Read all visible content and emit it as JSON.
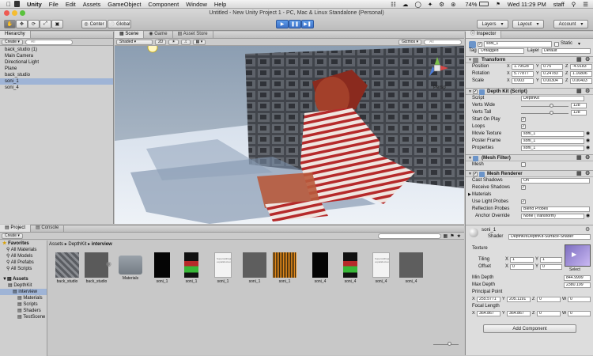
{
  "menubar": {
    "app": "Unity",
    "items": [
      "File",
      "Edit",
      "Assets",
      "GameObject",
      "Component",
      "Window",
      "Help"
    ],
    "battery": "74%",
    "clock": "Wed 11:29 PM",
    "user": "staff"
  },
  "window": {
    "title": "Untitled - New Unity Project 1 - PC, Mac & Linux Standalone (Personal)"
  },
  "toolbar": {
    "center": "Center",
    "global": "Global",
    "layers": "Layers",
    "layout": "Layout",
    "account": "Account"
  },
  "hierarchy": {
    "tab": "Hierarchy",
    "create": "Create",
    "search": "All",
    "items": [
      {
        "label": "back_studio (1)",
        "sel": false
      },
      {
        "label": "Main Camera",
        "sel": false
      },
      {
        "label": "Directional Light",
        "sel": false
      },
      {
        "label": "Plane",
        "sel": false
      },
      {
        "label": "back_studio",
        "sel": false
      },
      {
        "label": "soni_1",
        "sel": true
      },
      {
        "label": "soni_4",
        "sel": false
      }
    ]
  },
  "scene": {
    "tabs": [
      "Scene",
      "Game",
      "Asset Store"
    ],
    "shaded": "Shaded",
    "mode2d": "2D",
    "gizmos": "Gizmos",
    "search": "All",
    "persp": "Persp"
  },
  "project": {
    "tabs": [
      "Project",
      "Console"
    ],
    "create": "Create",
    "search": "",
    "breadcrumb": [
      "Assets",
      "DepthKit",
      "interview"
    ],
    "favorites_label": "Favorites",
    "favorites": [
      "All Materials",
      "All Models",
      "All Prefabs",
      "All Scripts"
    ],
    "assets_label": "Assets",
    "tree": [
      "DepthKit",
      "interview",
      "Materials",
      "Scripts",
      "Shaders",
      "TestScene"
    ],
    "items": [
      {
        "label": "back_studio",
        "kind": "photo"
      },
      {
        "label": "back_studio",
        "kind": "dark"
      },
      {
        "label": "Materials",
        "kind": "folder"
      },
      {
        "label": "soni_1",
        "kind": "black"
      },
      {
        "label": "soni_1",
        "kind": "figure"
      },
      {
        "label": "soni_1",
        "kind": "doc"
      },
      {
        "label": "soni_1",
        "kind": "gray"
      },
      {
        "label": "soni_1",
        "kind": "audio"
      },
      {
        "label": "soni_4",
        "kind": "black"
      },
      {
        "label": "soni_4",
        "kind": "figure"
      },
      {
        "label": "soni_4",
        "kind": "doc"
      },
      {
        "label": "soni_4",
        "kind": "gray"
      }
    ],
    "doc_text": "Supercalifragilistic expialidocious"
  },
  "inspector": {
    "tab": "Inspector",
    "object_name": "soni_1",
    "static": "Static",
    "tag_label": "Tag",
    "tag": "Untagged",
    "layer_label": "Layer",
    "layer": "Default",
    "transform": {
      "title": "Transform",
      "rows": [
        {
          "label": "Position",
          "x": "1.79528",
          "y": "0.75",
          "z": "-4.9183"
        },
        {
          "label": "Rotation",
          "x": "5.77877",
          "y": "0.24783",
          "z": "1.16806"
        },
        {
          "label": "Scale",
          "x": "0.003",
          "y": "0.00304",
          "z": "0.00403"
        }
      ]
    },
    "depthkit": {
      "title": "Depth Kit (Script)",
      "script_label": "Script",
      "script": "DepthKit",
      "verts_wide_label": "Verts Wide",
      "verts_wide": "128",
      "verts_wide_frac": 0.65,
      "verts_tall_label": "Verts Tall",
      "verts_tall": "128",
      "verts_tall_frac": 0.65,
      "start_on_play": "Start On Play",
      "loops": "Loops",
      "movie_texture_label": "Movie Texture",
      "movie_texture": "soni_1",
      "poster_frame_label": "Poster Frame",
      "poster_frame": "soni_1",
      "properties_label": "Properties",
      "properties": "soni_1"
    },
    "mesh_filter": {
      "title": "(Mesh Filter)",
      "mesh_label": "Mesh",
      "mesh": ""
    },
    "mesh_renderer": {
      "title": "Mesh Renderer",
      "cast_shadows_label": "Cast Shadows",
      "cast_shadows": "On",
      "receive_shadows": "Receive Shadows",
      "materials": "Materials",
      "use_light_probes": "Use Light Probes",
      "reflection_probes_label": "Reflection Probes",
      "reflection_probes": "Blend Probes",
      "anchor_override_label": "Anchor Override",
      "anchor_override": "None (Transform)"
    },
    "material": {
      "name": "soni_1",
      "shader_label": "Shader",
      "shader": "DepthKit/DepthKit-Surface-Shader",
      "texture_label": "Texture",
      "select": "Select",
      "tiling_label": "Tiling",
      "tiling_x": "1",
      "tiling_y": "1",
      "offset_label": "Offset",
      "offset_x": "0",
      "offset_y": "0",
      "min_depth_label": "Min Depth",
      "min_depth": "844.9999",
      "max_depth_label": "Max Depth",
      "max_depth": "2380.199",
      "principal_point_label": "Principal Point",
      "pp_x": "255.5771",
      "pp_y": "205.1191",
      "pp_z": "0",
      "pp_w": "0",
      "focal_length_label": "Focal Length",
      "fl_x": "364.867",
      "fl_y": "364.867",
      "fl_z": "0",
      "fl_w": "0"
    },
    "add_component": "Add Component"
  },
  "colors": {
    "selection": "#9fb4d6",
    "play_blue": "#4a86d8",
    "sky": "#8fa0b3",
    "component_icon": "#6b94c9"
  }
}
